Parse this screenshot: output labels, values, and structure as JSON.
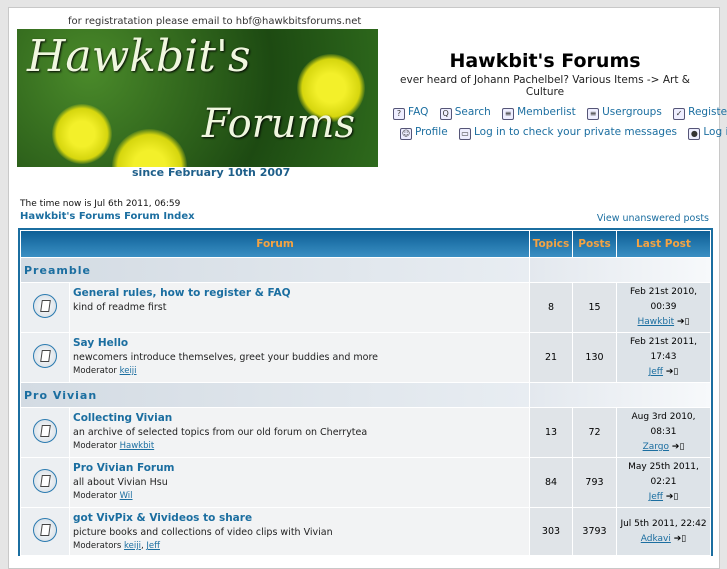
{
  "header": {
    "registration_note": "for registratation please email to hbf@hawkbitsforums.net",
    "banner_line1": "Hawkbit's",
    "banner_line2": "Forums",
    "since": "since February 10th 2007",
    "title": "Hawkbit's Forums",
    "description": "ever heard of Johann Pachelbel? Various Items -> Art & Culture"
  },
  "nav": {
    "faq": "FAQ",
    "search": "Search",
    "memberlist": "Memberlist",
    "usergroups": "Usergroups",
    "register": "Register",
    "profile": "Profile",
    "pm": "Log in to check your private messages",
    "login": "Log in"
  },
  "time": "The time now is Jul 6th 2011, 06:59",
  "index_link": "Hawkbit's Forums Forum Index",
  "unanswered": "View unanswered posts",
  "table": {
    "headers": [
      "Forum",
      "Topics",
      "Posts",
      "Last Post"
    ],
    "categories": [
      {
        "name": "Preamble",
        "forums": [
          {
            "name": "General rules, how to register & FAQ",
            "desc": "kind of readme first",
            "topics": "8",
            "posts": "15",
            "last_date": "Feb 21st 2010, 00:39",
            "last_user": "Hawkbit"
          },
          {
            "name": "Say Hello",
            "desc": "newcomers introduce themselves, greet your buddies and more",
            "mod_label": "Moderator",
            "mods": [
              "keiji"
            ],
            "topics": "21",
            "posts": "130",
            "last_date": "Feb 21st 2011, 17:43",
            "last_user": "Jeff"
          }
        ]
      },
      {
        "name": "Pro Vivian",
        "forums": [
          {
            "name": "Collecting Vivian",
            "desc": "an archive of selected topics from our old forum on Cherrytea",
            "mod_label": "Moderator",
            "mods": [
              "Hawkbit"
            ],
            "topics": "13",
            "posts": "72",
            "last_date": "Aug 3rd 2010, 08:31",
            "last_user": "Zargo"
          },
          {
            "name": "Pro Vivian Forum",
            "desc": "all about Vivian Hsu",
            "mod_label": "Moderator",
            "mods": [
              "Wil"
            ],
            "topics": "84",
            "posts": "793",
            "last_date": "May 25th 2011, 02:21",
            "last_user": "Jeff"
          },
          {
            "name": "got VivPix & Vivideos to share",
            "desc": "picture books and collections of video clips with Vivian",
            "mod_label": "Moderators",
            "mods": [
              "keiji",
              "Jeff"
            ],
            "topics": "303",
            "posts": "3793",
            "last_date": "Jul 5th 2011, 22:42",
            "last_user": "Adkavi"
          }
        ]
      }
    ]
  }
}
